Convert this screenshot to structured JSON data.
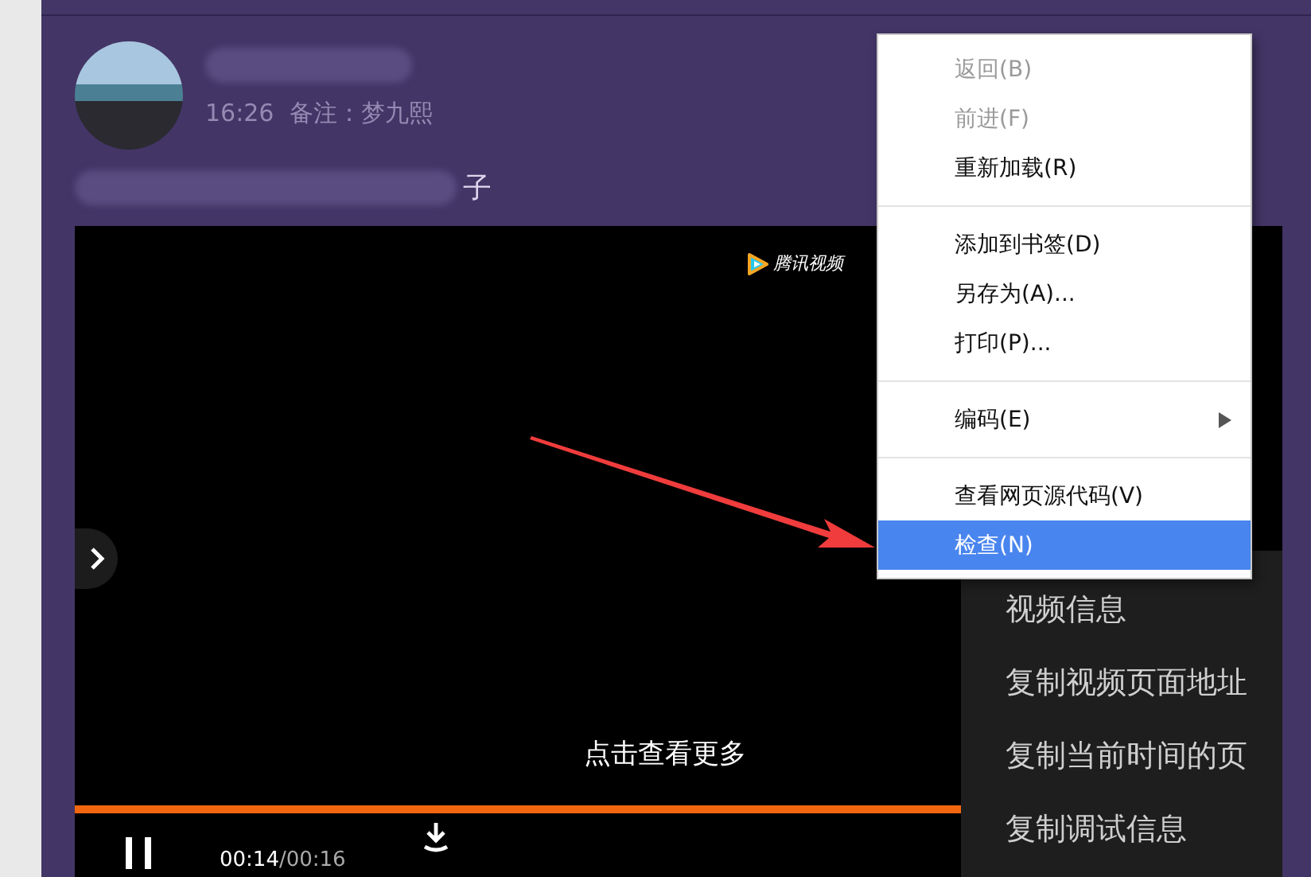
{
  "post": {
    "time": "16:26",
    "remark": "备注：梦九熙",
    "message_tail": "子"
  },
  "player": {
    "logo_text": "腾讯视频",
    "overlay_text": "点击查看更多",
    "current_time": "00:14",
    "duration": "/00:16",
    "progress": {
      "level": 0.875
    }
  },
  "browser_menu": {
    "items": [
      {
        "kind": "item",
        "label": "返回(B)",
        "disabled": true,
        "selected": false
      },
      {
        "kind": "item",
        "label": "前进(F)",
        "disabled": true,
        "selected": false
      },
      {
        "kind": "item",
        "label": "重新加载(R)",
        "disabled": false,
        "selected": false
      },
      {
        "kind": "separator"
      },
      {
        "kind": "item",
        "label": "添加到书签(D)",
        "disabled": false,
        "selected": false
      },
      {
        "kind": "item",
        "label": "另存为(A)...",
        "disabled": false,
        "selected": false
      },
      {
        "kind": "item",
        "label": "打印(P)...",
        "disabled": false,
        "selected": false
      },
      {
        "kind": "separator"
      },
      {
        "kind": "submenu",
        "label": "编码(E)",
        "disabled": false,
        "selected": false
      },
      {
        "kind": "separator"
      },
      {
        "kind": "item",
        "label": "查看网页源代码(V)",
        "disabled": false,
        "selected": false
      },
      {
        "kind": "item",
        "label": "检查(N)",
        "disabled": false,
        "selected": true
      }
    ]
  },
  "player_menu": {
    "items": [
      "视频信息",
      "复制视频页面地址",
      "复制当前时间的页",
      "复制调试信息"
    ]
  }
}
